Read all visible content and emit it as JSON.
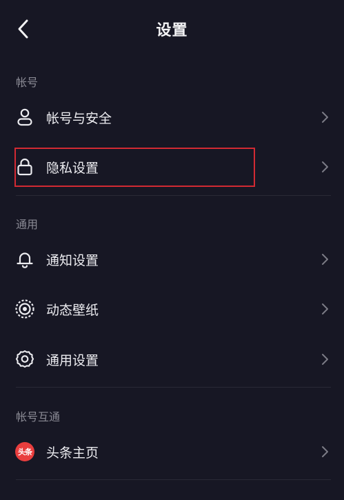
{
  "header": {
    "title": "设置",
    "back_icon": "chevron-left-icon"
  },
  "sections": [
    {
      "title": "帐号",
      "items": [
        {
          "label": "帐号与安全",
          "icon": "user-icon"
        },
        {
          "label": "隐私设置",
          "icon": "lock-icon"
        }
      ]
    },
    {
      "title": "通用",
      "items": [
        {
          "label": "通知设置",
          "icon": "bell-icon"
        },
        {
          "label": "动态壁纸",
          "icon": "dynamic-wallpaper-icon"
        },
        {
          "label": "通用设置",
          "icon": "gear-icon"
        }
      ]
    },
    {
      "title": "帐号互通",
      "items": [
        {
          "label": "头条主页",
          "icon": "toutiao-logo",
          "logo_text": "头条"
        }
      ]
    }
  ],
  "colors": {
    "background": "#171724",
    "text": "#ECECF0",
    "section_header": "#8A8A94",
    "chevron": "#7C7C86",
    "highlight": "#D32A33",
    "toutiao_brand": "#E93E3E"
  }
}
